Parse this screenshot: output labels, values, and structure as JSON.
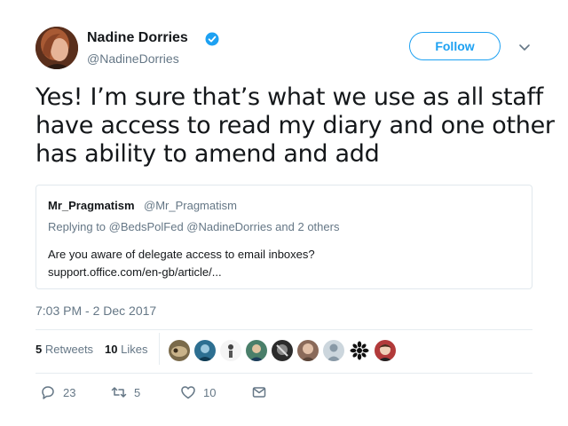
{
  "author": {
    "display_name": "Nadine Dorries",
    "handle": "@NadineDorries",
    "verified": true,
    "verified_color": "#1da1f2"
  },
  "follow_button": {
    "label": "Follow"
  },
  "tweet": {
    "text_lines": [
      "Yes! I’m sure that’s what we use as all staff",
      "have access to read my diary and one other",
      "has ability to amend and add"
    ]
  },
  "quoted_tweet": {
    "name": "Mr_Pragmatism",
    "handle": "@Mr_Pragmatism",
    "reply_context": "Replying to @BedsPolFed @NadineDorries and 2 others",
    "text_lines": [
      "Are you aware of delegate access to email inboxes?",
      "support.office.com/en-gb/article/..."
    ]
  },
  "timestamp": "7:03 PM - 2 Dec 2017",
  "stats": {
    "retweets_count": "5",
    "retweets_label": "Retweets",
    "likes_count": "10",
    "likes_label": "Likes"
  },
  "actions": {
    "reply_count": "23",
    "retweet_count": "5",
    "like_count": "10"
  },
  "colors": {
    "accent": "#1da1f2",
    "muted_text": "#657786",
    "border": "#e1e8ed"
  },
  "icons": [
    "verified-badge-icon",
    "chevron-down-icon",
    "reply-icon",
    "retweet-icon",
    "heart-icon",
    "direct-message-icon"
  ]
}
